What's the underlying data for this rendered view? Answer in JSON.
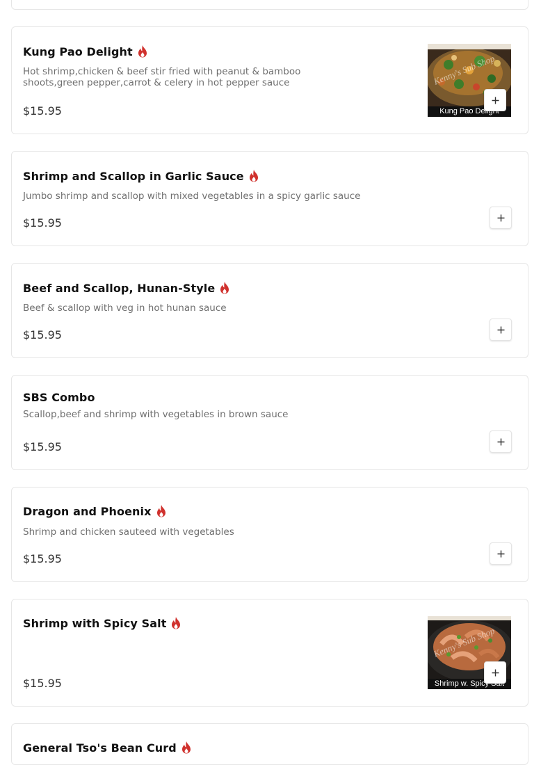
{
  "items": [
    {
      "name": "Kung Pao Delight",
      "spicy": true,
      "description": "Hot shrimp,chicken & beef stir fried with peanut & bamboo shoots,green pepper,carrot & celery in hot pepper sauce",
      "price": "$15.95",
      "image_caption": "Kung Pao Delight",
      "image_watermark": "Kenny's Sub Shop"
    },
    {
      "name": "Shrimp and Scallop in Garlic Sauce",
      "spicy": true,
      "description": "Jumbo shrimp and scallop with mixed vegetables in a spicy garlic sauce",
      "price": "$15.95"
    },
    {
      "name": "Beef and Scallop, Hunan-Style",
      "spicy": true,
      "description": "Beef & scallop with veg in hot hunan sauce",
      "price": "$15.95"
    },
    {
      "name": "SBS Combo",
      "spicy": false,
      "description": "Scallop,beef and shrimp with vegetables in brown sauce",
      "price": "$15.95"
    },
    {
      "name": "Dragon and Phoenix",
      "spicy": true,
      "description": "Shrimp and chicken sauteed with vegetables",
      "price": "$15.95"
    },
    {
      "name": "Shrimp with Spicy Salt",
      "spicy": true,
      "description": "",
      "price": "$15.95",
      "image_caption": "Shrimp w. Spicy Salt",
      "image_watermark": "Kenny's Sub Shop"
    },
    {
      "name": "General Tso's Bean Curd",
      "spicy": true
    }
  ],
  "icons": {
    "spicy": "flame-icon",
    "add": "plus-icon"
  },
  "colors": {
    "spicy_icon": "#d0312d",
    "card_border": "#e6e6e6",
    "description_text": "#6f6f6f"
  }
}
